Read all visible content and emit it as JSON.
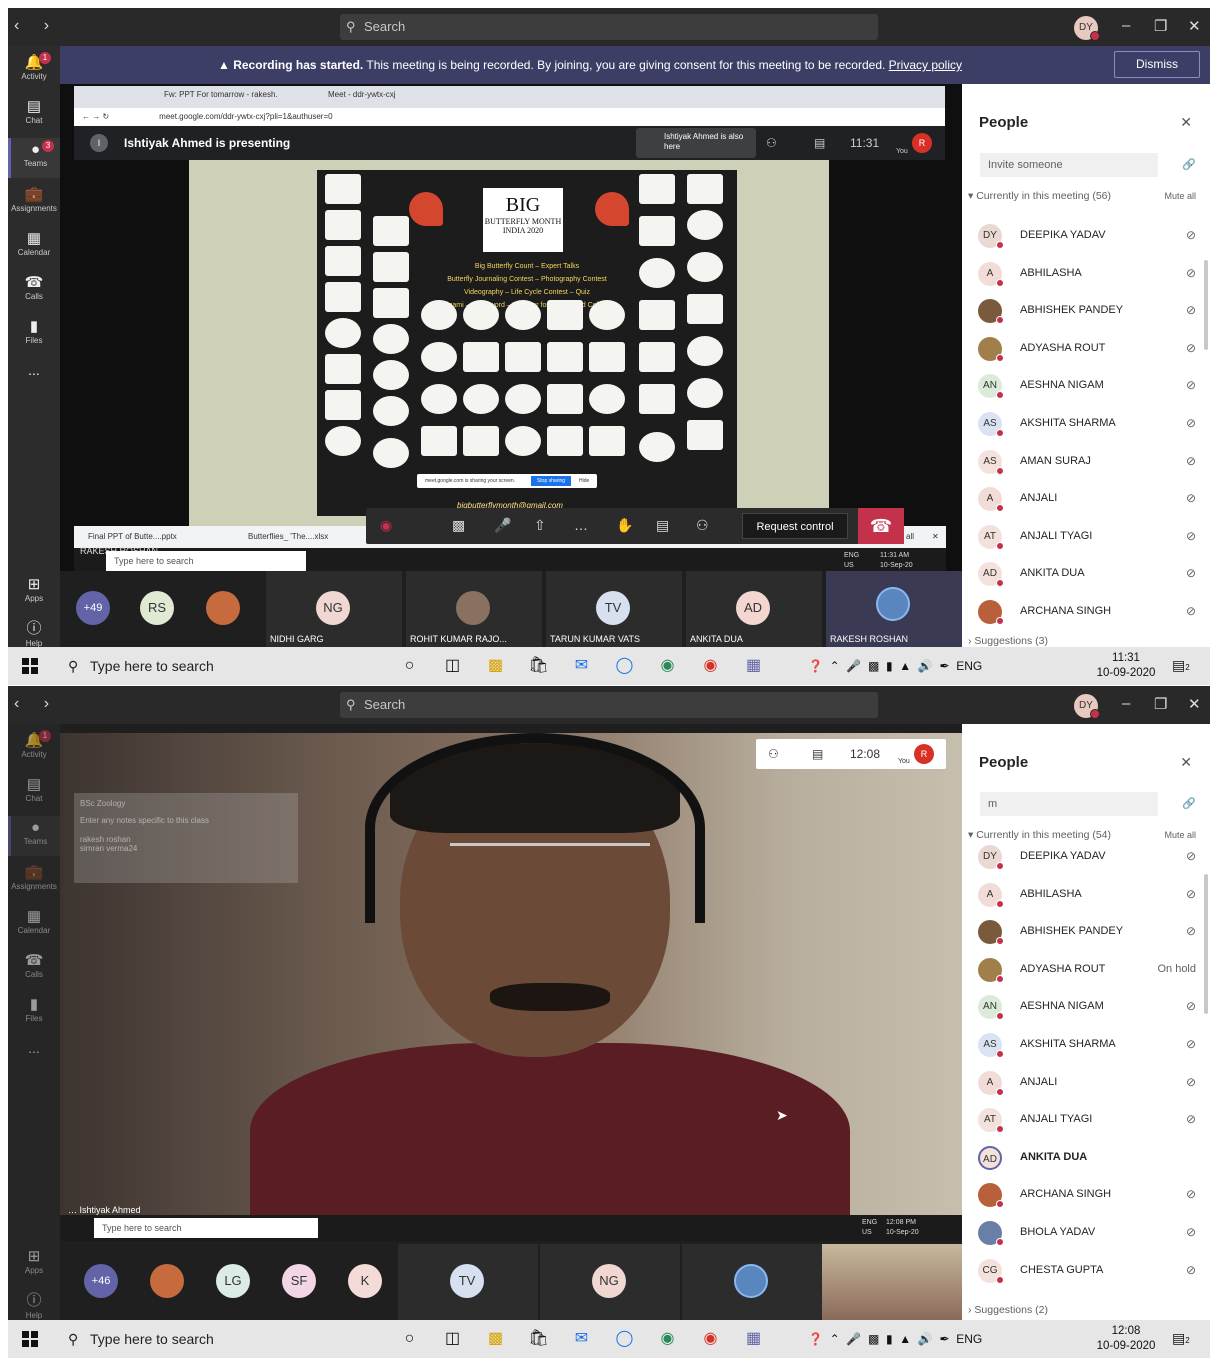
{
  "shot1": {
    "search_placeholder": "Search",
    "user_initials": "DY",
    "rail": [
      {
        "label": "Activity",
        "icon": "bell-icon",
        "badge": "1"
      },
      {
        "label": "Chat",
        "icon": "chat-icon"
      },
      {
        "label": "Teams",
        "icon": "teams-icon",
        "badge": "3"
      },
      {
        "label": "Assignments",
        "icon": "assignments-icon"
      },
      {
        "label": "Calendar",
        "icon": "calendar-icon"
      },
      {
        "label": "Calls",
        "icon": "phone-icon"
      },
      {
        "label": "Files",
        "icon": "files-icon"
      },
      {
        "label": "...",
        "icon": "more-icon"
      }
    ],
    "rail_bottom": [
      {
        "label": "Apps",
        "icon": "apps-icon"
      },
      {
        "label": "Help",
        "icon": "help-icon"
      }
    ],
    "banner": {
      "bold": "Recording has started.",
      "text": " This meeting is being recorded. By joining, you are giving consent for this meeting to be recorded. ",
      "link": "Privacy policy",
      "dismiss": "Dismiss"
    },
    "chrome": {
      "tab1": "Fw: PPT For tomarrow - rakesh.",
      "tab2": "Meet - ddr-ywtx-cxj",
      "url": "meet.google.com/ddr-ywtx-cxj?pli=1&authuser=0"
    },
    "meet": {
      "presenting": "Ishtiyak Ahmed is presenting",
      "pin_initial": "I",
      "also_here": "Ishtiyak Ahmed is also here",
      "time": "11:31",
      "you": "You",
      "you_initial": "R"
    },
    "slide": {
      "big": "BIG",
      "sub": "BUTTERFLY MONTH INDIA 2020",
      "events": [
        "Big Butterfly Count – Expert Talks",
        "Butterfly Journaling Contest – Photography Contest",
        "Videography – Life Cycle Contest – Quiz",
        "Origami – Crossword – Webinar for School and Colleges"
      ],
      "email": "bigbutterflymonth@gmail.com",
      "sharing_text": "meet.google.com is sharing your screen.",
      "stop_sharing": "Stop sharing",
      "hide": "Hide"
    },
    "call_controls": {
      "request_control": "Request control"
    },
    "downloads": {
      "item1": "Final PPT of Butte....pptx",
      "item2": "Butterflies_ 'The....xlsx",
      "show_all": "all"
    },
    "inner_taskbar": {
      "name_overlay": "RAKESH ROSHAN",
      "search": "Type here to search",
      "lang": "ENG",
      "region": "US",
      "time": "11:31 AM",
      "date": "10-Sep-20"
    },
    "people": {
      "title": "People",
      "invite_placeholder": "Invite someone",
      "current": "Currently in this meeting (56)",
      "mute_all": "Mute all",
      "rows": [
        {
          "initials": "DY",
          "name": "DEEPIKA YADAV",
          "bg": "#ead8d2"
        },
        {
          "initials": "A",
          "name": "ABHILASHA",
          "bg": "#f2dcd8"
        },
        {
          "initials": "",
          "name": "ABHISHEK PANDEY",
          "bg": "#7a5a3c"
        },
        {
          "initials": "",
          "name": "ADYASHA ROUT",
          "bg": "#a07f4a"
        },
        {
          "initials": "AN",
          "name": "AESHNA NIGAM",
          "bg": "#dcebd9"
        },
        {
          "initials": "AS",
          "name": "AKSHITA SHARMA",
          "bg": "#dbe3f3"
        },
        {
          "initials": "AS",
          "name": "AMAN SURAJ",
          "bg": "#f3e1dc"
        },
        {
          "initials": "A",
          "name": "ANJALI",
          "bg": "#f2dcd8"
        },
        {
          "initials": "AT",
          "name": "ANJALI TYAGI",
          "bg": "#f3e1dc"
        },
        {
          "initials": "AD",
          "name": "ANKITA DUA",
          "bg": "#f3e1dc"
        },
        {
          "initials": "",
          "name": "ARCHANA SINGH",
          "bg": "#b8603a"
        }
      ],
      "suggestions": "Suggestions (3)"
    },
    "gallery": {
      "more": "+49",
      "tiles": [
        {
          "initials": "RS",
          "name": ""
        },
        {
          "initials": "NG",
          "name": "NIDHI GARG"
        },
        {
          "initials": "",
          "name": "ROHIT KUMAR RAJO..."
        },
        {
          "initials": "TV",
          "name": "TARUN KUMAR VATS"
        },
        {
          "initials": "AD",
          "name": "ANKITA DUA"
        },
        {
          "initials": "",
          "name": "RAKESH ROSHAN"
        }
      ]
    },
    "taskbar": {
      "search": "Type here to search",
      "lang": "ENG",
      "time": "11:31",
      "date": "10-09-2020",
      "notif": "2"
    }
  },
  "shot2": {
    "search_placeholder": "Search",
    "user_initials": "DY",
    "video": {
      "time": "12:08",
      "you": "You",
      "you_initial": "R",
      "name": "Ishtiyak Ahmed",
      "notes_title": "BSc Zoology",
      "notes_placeholder": "Enter any notes specific to this class",
      "notes_names": "rakesh roshan\nsimran verma24"
    },
    "inner_taskbar": {
      "search": "Type here to search",
      "lang": "ENG",
      "region": "US",
      "time": "12:08 PM",
      "date": "10-Sep-20"
    },
    "people": {
      "title": "People",
      "invite_value": "m",
      "current": "Currently in this meeting (54)",
      "mute_all": "Mute all",
      "rows": [
        {
          "initials": "DY",
          "name": "DEEPIKA YADAV",
          "bg": "#ead8d2",
          "status": "mic"
        },
        {
          "initials": "A",
          "name": "ABHILASHA",
          "bg": "#f2dcd8",
          "status": "mic"
        },
        {
          "initials": "",
          "name": "ABHISHEK PANDEY",
          "bg": "#7a5a3c",
          "status": "mic"
        },
        {
          "initials": "",
          "name": "ADYASHA ROUT",
          "bg": "#a07f4a",
          "status": "On hold"
        },
        {
          "initials": "AN",
          "name": "AESHNA NIGAM",
          "bg": "#dcebd9",
          "status": "mic"
        },
        {
          "initials": "AS",
          "name": "AKSHITA SHARMA",
          "bg": "#dbe3f3",
          "status": "mic"
        },
        {
          "initials": "A",
          "name": "ANJALI",
          "bg": "#f2dcd8",
          "status": "mic"
        },
        {
          "initials": "AT",
          "name": "ANJALI TYAGI",
          "bg": "#f3e1dc",
          "status": "mic"
        },
        {
          "initials": "AD",
          "name": "ANKITA DUA",
          "bg": "#f3e1dc",
          "status": "speaking"
        },
        {
          "initials": "",
          "name": "ARCHANA SINGH",
          "bg": "#b8603a",
          "status": "mic"
        },
        {
          "initials": "",
          "name": "BHOLA YADAV",
          "bg": "#6a7fa8",
          "status": "mic"
        },
        {
          "initials": "CG",
          "name": "CHESTA GUPTA",
          "bg": "#f3e1dc",
          "status": "mic"
        }
      ],
      "suggestions": "Suggestions (2)"
    },
    "gallery": {
      "more": "+46",
      "tiles": [
        {
          "initials": "",
          "name": ""
        },
        {
          "initials": "LG",
          "name": ""
        },
        {
          "initials": "SF",
          "name": ""
        },
        {
          "initials": "K",
          "name": ""
        },
        {
          "initials": "TV",
          "name": ""
        },
        {
          "initials": "NG",
          "name": ""
        },
        {
          "initials": "",
          "name": ""
        }
      ]
    },
    "taskbar": {
      "search": "Type here to search",
      "lang": "ENG",
      "time": "12:08",
      "date": "10-09-2020",
      "notif": "2"
    }
  }
}
